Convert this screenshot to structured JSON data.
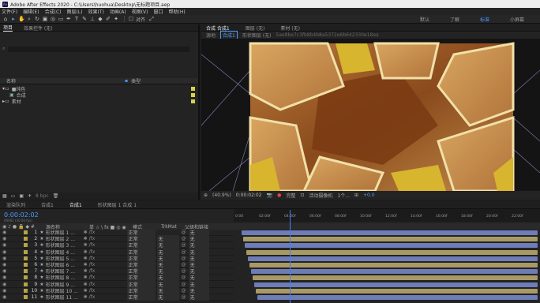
{
  "titlebar": {
    "title": "Adobe After Effects 2020 - C:\\Users\\huohua\\Desktop\\无标题项目.aep"
  },
  "menu": [
    "文件(F)",
    "编辑(E)",
    "合成(C)",
    "图层(L)",
    "效果(T)",
    "动画(A)",
    "视图(V)",
    "窗口",
    "帮助(H)"
  ],
  "toolbar": {
    "snap_label": "对齐",
    "workspaces": [
      "默认",
      "了解",
      "标准",
      "小屏幕"
    ],
    "active_workspace": "标准"
  },
  "project": {
    "tabs": [
      "项目",
      "效果控件 (无)"
    ],
    "search_placeholder": "",
    "columns": {
      "name": "名称",
      "type": "类型"
    },
    "items": [
      {
        "name": "■纯色",
        "type": ""
      },
      {
        "name": "合成",
        "type": ""
      },
      {
        "name": "素材",
        "type": ""
      }
    ],
    "footer_bpc": "8 bpc"
  },
  "composition": {
    "tabs": [
      "合成 合成1",
      "图层 (无)",
      "素材 (无)"
    ],
    "crumbs": [
      "源地",
      "合成1",
      "形状图层 (无)"
    ],
    "crumb_hash": "5ae8be7c3fb8b4b8a5372e6b642330e18ea",
    "controls": {
      "zoom": "(40.9%)",
      "time": "0:00:02:02",
      "resolution": "完整",
      "camera": "活动摄像机",
      "views": "1个...",
      "offset": "+0.0"
    }
  },
  "timeline": {
    "tabs": [
      "渲染队列",
      "合成1",
      "合成1",
      "形状图层 1 合成 1"
    ],
    "timecode": "0:00:02:02",
    "fps": "00062 (30.00 fps)",
    "ruler_ticks": [
      "0:00",
      "02:00f",
      "04:00f",
      "06:00f",
      "08:00f",
      "10:00f",
      "12:00f",
      "14:00f",
      "16:00f",
      "18:00f",
      "20:00f",
      "22:00f"
    ],
    "columns": {
      "source": "源名称",
      "switches": "单 ☆ \\ fx ■ ◎ ◉",
      "mode": "模式",
      "trkmat": "TrkMat",
      "parent": "父级和链接"
    },
    "layers": [
      {
        "num": "1",
        "name": "形状图层 1 ...",
        "mode": "正常",
        "trk": "",
        "parent": "无",
        "color": "#b7a24a"
      },
      {
        "num": "2",
        "name": "形状图层 2 ...",
        "mode": "正常",
        "trk": "无",
        "parent": "无",
        "color": "#b7a24a"
      },
      {
        "num": "3",
        "name": "形状图层 3 ...",
        "mode": "正常",
        "trk": "无",
        "parent": "无",
        "color": "#b7a24a"
      },
      {
        "num": "4",
        "name": "形状图层 4 ...",
        "mode": "正常",
        "trk": "无",
        "parent": "无",
        "color": "#b7a24a"
      },
      {
        "num": "5",
        "name": "形状图层 5 ...",
        "mode": "正常",
        "trk": "无",
        "parent": "无",
        "color": "#b7a24a"
      },
      {
        "num": "6",
        "name": "形状图层 6 ...",
        "mode": "正常",
        "trk": "无",
        "parent": "无",
        "color": "#b7a24a"
      },
      {
        "num": "7",
        "name": "形状图层 7 ...",
        "mode": "正常",
        "trk": "无",
        "parent": "无",
        "color": "#b7a24a"
      },
      {
        "num": "8",
        "name": "形状图层 8 ...",
        "mode": "正常",
        "trk": "无",
        "parent": "无",
        "color": "#b7a24a"
      },
      {
        "num": "9",
        "name": "形状图层 9 ...",
        "mode": "正常",
        "trk": "无",
        "parent": "无",
        "color": "#b7a24a"
      },
      {
        "num": "10",
        "name": "形状图层 10 ...",
        "mode": "正常",
        "trk": "无",
        "parent": "无",
        "color": "#b7a24a"
      },
      {
        "num": "11",
        "name": "形状图层 11 ...",
        "mode": "正常",
        "trk": "无",
        "parent": "无",
        "color": "#b7a24a"
      }
    ]
  },
  "colors": {
    "accent": "#4d9bff",
    "bar_blue": "#6e7db8",
    "bar_gold": "#a89a64"
  }
}
